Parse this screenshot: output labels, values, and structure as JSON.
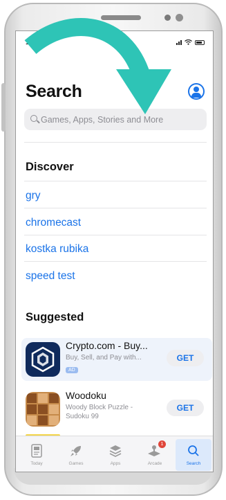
{
  "status_bar": {
    "time": "12"
  },
  "header": {
    "title": "Search"
  },
  "search": {
    "placeholder": "Games, Apps, Stories and More"
  },
  "discover": {
    "title": "Discover",
    "items": [
      "gry",
      "chromecast",
      "kostka rubika",
      "speed test"
    ]
  },
  "suggested": {
    "title": "Suggested",
    "apps": [
      {
        "name": "Crypto.com - Buy...",
        "subtitle": "Buy, Sell, and Pay with...",
        "badge": "AD",
        "button": "GET"
      },
      {
        "name": "Woodoku",
        "subtitle_line1": "Woody Block Puzzle -",
        "subtitle_line2": "Sudoku 99",
        "button": "GET"
      }
    ]
  },
  "tabbar": {
    "tabs": [
      {
        "label": "Today",
        "icon": "today-icon"
      },
      {
        "label": "Games",
        "icon": "rocket-icon"
      },
      {
        "label": "Apps",
        "icon": "layers-icon"
      },
      {
        "label": "Arcade",
        "icon": "joystick-icon",
        "badge": "1"
      },
      {
        "label": "Search",
        "icon": "search-icon",
        "active": true
      }
    ]
  },
  "colors": {
    "accent": "#1a73e8",
    "arrow": "#2ec4b6",
    "badge": "#e0463a"
  }
}
